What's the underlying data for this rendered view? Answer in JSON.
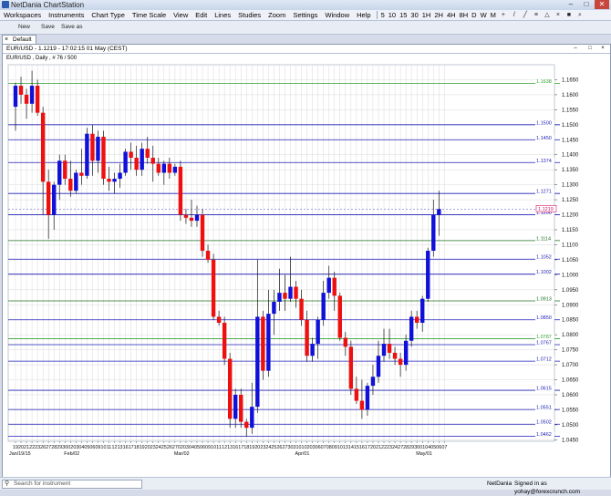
{
  "window": {
    "title": "NetDania ChartStation"
  },
  "menu": {
    "items": [
      "Workspaces",
      "Instruments",
      "Chart Type",
      "Time Scale",
      "View",
      "Edit",
      "Lines",
      "Studies",
      "Zoom",
      "Settings",
      "Window",
      "Help"
    ],
    "timeframes": [
      "5",
      "10",
      "15",
      "30",
      "1H",
      "2H",
      "4H",
      "8H",
      "D",
      "W",
      "M"
    ]
  },
  "toolbar": {
    "new_label": "New",
    "save_label": "Save",
    "save_as_label": "Save as"
  },
  "tab": {
    "label": "Default"
  },
  "chart_header": {
    "label": "EUR/USD - 1.1219 - 17:02:15  01 May (CEST)",
    "sublabel": "EUR/USD , Daily , # 76 / 500"
  },
  "chart_data": {
    "type": "candlestick",
    "symbol": "EUR/USD",
    "ylim": [
      1.0445,
      1.17
    ],
    "y_ticks": [
      "1.1650",
      "1.1600",
      "1.1550",
      "1.1500",
      "1.1450",
      "1.1400",
      "1.1350",
      "1.1300",
      "1.1250",
      "1.1200",
      "1.1150",
      "1.1100",
      "1.1050",
      "1.1000",
      "1.0950",
      "1.0900",
      "1.0850",
      "1.0800",
      "1.0750",
      "1.0700",
      "1.0650",
      "1.0600",
      "1.0550",
      "1.0500",
      "1.0450"
    ],
    "current_price": "1.1219",
    "x_labels": [
      "19",
      "20",
      "21",
      "22",
      "23",
      "26",
      "27",
      "28",
      "29",
      "30",
      "02",
      "03",
      "04",
      "05",
      "06",
      "09",
      "10",
      "11",
      "12",
      "13",
      "16",
      "17",
      "18",
      "19",
      "20",
      "23",
      "24",
      "25",
      "26",
      "27",
      "02",
      "03",
      "04",
      "05",
      "06",
      "09",
      "10",
      "11",
      "12",
      "13",
      "16",
      "17",
      "18",
      "19",
      "20",
      "23",
      "24",
      "25",
      "26",
      "27",
      "30",
      "31",
      "01",
      "02",
      "03",
      "06",
      "07",
      "08",
      "09",
      "10",
      "13",
      "14",
      "15",
      "16",
      "17",
      "20",
      "21",
      "22",
      "23",
      "24",
      "27",
      "28",
      "29",
      "30",
      "01",
      "04",
      "05",
      "06",
      "07"
    ],
    "month_labels": [
      {
        "text": "Jan/19/15",
        "index": 0
      },
      {
        "text": "Feb/02",
        "index": 10
      },
      {
        "text": "Mar/02",
        "index": 30
      },
      {
        "text": "Apr/01",
        "index": 52
      },
      {
        "text": "May/01",
        "index": 74
      }
    ],
    "levels": [
      {
        "value": 1.1638,
        "color": "#2fa12f"
      },
      {
        "value": 1.15,
        "color": "#1f1fb8"
      },
      {
        "value": 1.145,
        "color": "#1f1fb8"
      },
      {
        "value": 1.1374,
        "color": "#1f1fb8"
      },
      {
        "value": 1.1271,
        "color": "#1f1fb8"
      },
      {
        "value": 1.12,
        "color": "#1f1fb8"
      },
      {
        "value": 1.1114,
        "color": "#1f6f1f"
      },
      {
        "value": 1.1052,
        "color": "#1f1fb8"
      },
      {
        "value": 1.1002,
        "color": "#1f1fb8"
      },
      {
        "value": 1.0913,
        "color": "#1f6f1f"
      },
      {
        "value": 1.085,
        "color": "#1f1fb8"
      },
      {
        "value": 1.0787,
        "color": "#2fa12f"
      },
      {
        "value": 1.0767,
        "color": "#1f1fb8"
      },
      {
        "value": 1.0712,
        "color": "#1f1fb8"
      },
      {
        "value": 1.0615,
        "color": "#1f1fb8"
      },
      {
        "value": 1.0551,
        "color": "#1f1fb8"
      },
      {
        "value": 1.0502,
        "color": "#1f1fb8"
      },
      {
        "value": 1.0462,
        "color": "#1f1fb8"
      }
    ],
    "level_labels": [
      "1.1638",
      "1.1500",
      "1.1450",
      "1.1374",
      "1.1271",
      "1.1200",
      "1.1114",
      "1.1052",
      "1.1002",
      "1.0913",
      "1.0850",
      "1.0787",
      "1.0767",
      "1.0712",
      "1.0615",
      "1.0551",
      "1.0502",
      "1.0462"
    ],
    "colors": {
      "up": "#1010d8",
      "down": "#ee1010",
      "grid": "#d9d9d9",
      "current": "#6f6fd8"
    },
    "candles": [
      [
        1.156,
        1.164,
        1.148,
        1.163
      ],
      [
        1.163,
        1.166,
        1.157,
        1.16
      ],
      [
        1.16,
        1.162,
        1.152,
        1.157
      ],
      [
        1.157,
        1.168,
        1.154,
        1.163
      ],
      [
        1.163,
        1.165,
        1.153,
        1.154
      ],
      [
        1.154,
        1.156,
        1.12,
        1.131
      ],
      [
        1.131,
        1.135,
        1.112,
        1.12
      ],
      [
        1.12,
        1.131,
        1.115,
        1.13
      ],
      [
        1.13,
        1.14,
        1.125,
        1.138
      ],
      [
        1.138,
        1.14,
        1.13,
        1.132
      ],
      [
        1.132,
        1.138,
        1.126,
        1.128
      ],
      [
        1.128,
        1.135,
        1.127,
        1.134
      ],
      [
        1.134,
        1.142,
        1.13,
        1.133
      ],
      [
        1.133,
        1.149,
        1.132,
        1.147
      ],
      [
        1.147,
        1.15,
        1.133,
        1.138
      ],
      [
        1.138,
        1.148,
        1.134,
        1.146
      ],
      [
        1.146,
        1.148,
        1.13,
        1.132
      ],
      [
        1.132,
        1.136,
        1.128,
        1.131
      ],
      [
        1.131,
        1.134,
        1.127,
        1.132
      ],
      [
        1.132,
        1.137,
        1.129,
        1.134
      ],
      [
        1.134,
        1.142,
        1.133,
        1.141
      ],
      [
        1.141,
        1.144,
        1.135,
        1.139
      ],
      [
        1.139,
        1.143,
        1.133,
        1.135
      ],
      [
        1.135,
        1.144,
        1.133,
        1.142
      ],
      [
        1.142,
        1.146,
        1.137,
        1.139
      ],
      [
        1.139,
        1.143,
        1.131,
        1.137
      ],
      [
        1.137,
        1.139,
        1.133,
        1.134
      ],
      [
        1.134,
        1.138,
        1.13,
        1.137
      ],
      [
        1.137,
        1.139,
        1.132,
        1.134
      ],
      [
        1.134,
        1.137,
        1.133,
        1.136
      ],
      [
        1.136,
        1.138,
        1.118,
        1.12
      ],
      [
        1.12,
        1.122,
        1.117,
        1.119
      ],
      [
        1.119,
        1.125,
        1.116,
        1.118
      ],
      [
        1.118,
        1.123,
        1.116,
        1.12
      ],
      [
        1.12,
        1.122,
        1.106,
        1.108
      ],
      [
        1.108,
        1.11,
        1.104,
        1.105
      ],
      [
        1.105,
        1.107,
        1.085,
        1.086
      ],
      [
        1.086,
        1.088,
        1.083,
        1.084
      ],
      [
        1.084,
        1.086,
        1.07,
        1.072
      ],
      [
        1.072,
        1.074,
        1.049,
        1.052
      ],
      [
        1.052,
        1.062,
        1.049,
        1.06
      ],
      [
        1.06,
        1.062,
        1.049,
        1.051
      ],
      [
        1.051,
        1.052,
        1.046,
        1.049
      ],
      [
        1.049,
        1.064,
        1.047,
        1.056
      ],
      [
        1.056,
        1.105,
        1.054,
        1.086
      ],
      [
        1.086,
        1.088,
        1.065,
        1.068
      ],
      [
        1.068,
        1.095,
        1.066,
        1.087
      ],
      [
        1.087,
        1.095,
        1.08,
        1.091
      ],
      [
        1.091,
        1.102,
        1.088,
        1.094
      ],
      [
        1.094,
        1.1,
        1.088,
        1.092
      ],
      [
        1.092,
        1.106,
        1.091,
        1.096
      ],
      [
        1.096,
        1.098,
        1.089,
        1.092
      ],
      [
        1.092,
        1.095,
        1.083,
        1.085
      ],
      [
        1.085,
        1.088,
        1.071,
        1.073
      ],
      [
        1.073,
        1.079,
        1.071,
        1.077
      ],
      [
        1.077,
        1.086,
        1.072,
        1.085
      ],
      [
        1.085,
        1.098,
        1.083,
        1.094
      ],
      [
        1.094,
        1.103,
        1.092,
        1.099
      ],
      [
        1.099,
        1.101,
        1.088,
        1.093
      ],
      [
        1.093,
        1.094,
        1.078,
        1.079
      ],
      [
        1.079,
        1.081,
        1.073,
        1.076
      ],
      [
        1.076,
        1.078,
        1.06,
        1.062
      ],
      [
        1.062,
        1.066,
        1.057,
        1.058
      ],
      [
        1.058,
        1.065,
        1.052,
        1.055
      ],
      [
        1.055,
        1.064,
        1.053,
        1.063
      ],
      [
        1.063,
        1.07,
        1.06,
        1.066
      ],
      [
        1.066,
        1.078,
        1.064,
        1.073
      ],
      [
        1.073,
        1.082,
        1.071,
        1.077
      ],
      [
        1.077,
        1.082,
        1.072,
        1.074
      ],
      [
        1.074,
        1.076,
        1.07,
        1.072
      ],
      [
        1.072,
        1.074,
        1.066,
        1.07
      ],
      [
        1.07,
        1.08,
        1.068,
        1.078
      ],
      [
        1.078,
        1.088,
        1.076,
        1.086
      ],
      [
        1.086,
        1.088,
        1.082,
        1.084
      ],
      [
        1.084,
        1.093,
        1.081,
        1.092
      ],
      [
        1.092,
        1.109,
        1.091,
        1.108
      ],
      [
        1.108,
        1.125,
        1.106,
        1.12
      ],
      [
        1.12,
        1.128,
        1.113,
        1.1219
      ]
    ]
  },
  "statusbar": {
    "search_placeholder": "Search for instrument",
    "brand": "NetDania",
    "user": "Signed in as yohay@forexcrunch.com"
  }
}
